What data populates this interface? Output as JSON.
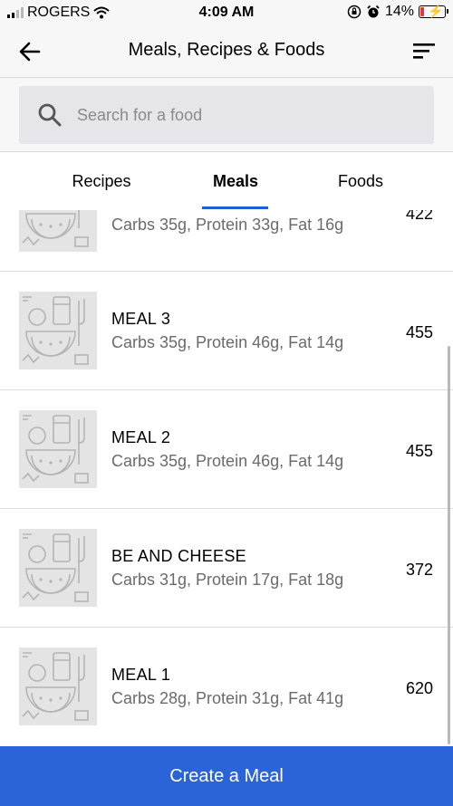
{
  "status_bar": {
    "carrier": "ROGERS",
    "time": "4:09 AM",
    "battery": "14%",
    "battery_level": 0.14,
    "battery_color": "#e53935"
  },
  "header": {
    "title": "Meals, Recipes & Foods",
    "back_icon": "arrow-left-icon",
    "sort_icon": "sort-icon"
  },
  "search": {
    "placeholder": "Search for a food",
    "value": ""
  },
  "tabs": [
    {
      "label": "Recipes",
      "active": false
    },
    {
      "label": "Meals",
      "active": true
    },
    {
      "label": "Foods",
      "active": false
    }
  ],
  "meals": [
    {
      "name": "",
      "macros": "Carbs 35g, Protein 33g, Fat 16g",
      "calories": "422"
    },
    {
      "name": "MEAL 3",
      "macros": "Carbs 35g, Protein 46g, Fat 14g",
      "calories": "455"
    },
    {
      "name": "MEAL 2",
      "macros": "Carbs 35g, Protein 46g, Fat 14g",
      "calories": "455"
    },
    {
      "name": "BE AND CHEESE",
      "macros": "Carbs 31g, Protein 17g, Fat 18g",
      "calories": "372"
    },
    {
      "name": "MEAL 1",
      "macros": "Carbs 28g, Protein 31g, Fat 41g",
      "calories": "620"
    }
  ],
  "create_button": {
    "label": "Create a Meal"
  },
  "colors": {
    "accent": "#2b63d9",
    "tab_underline": "#1a5fd6"
  }
}
